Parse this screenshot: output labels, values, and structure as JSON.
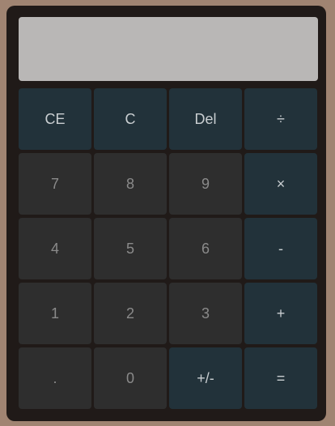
{
  "display": {
    "value": ""
  },
  "keys": {
    "ce": "CE",
    "c": "C",
    "del": "Del",
    "divide": "÷",
    "seven": "7",
    "eight": "8",
    "nine": "9",
    "multiply": "×",
    "four": "4",
    "five": "5",
    "six": "6",
    "subtract": "-",
    "one": "1",
    "two": "2",
    "three": "3",
    "add": "+",
    "decimal": ".",
    "zero": "0",
    "negate": "+/-",
    "equals": "="
  },
  "colors": {
    "background": "#a08472",
    "body": "#201a18",
    "display": "#b9b7b6",
    "number_key": "#2e2e2e",
    "function_key": "#22323a"
  }
}
